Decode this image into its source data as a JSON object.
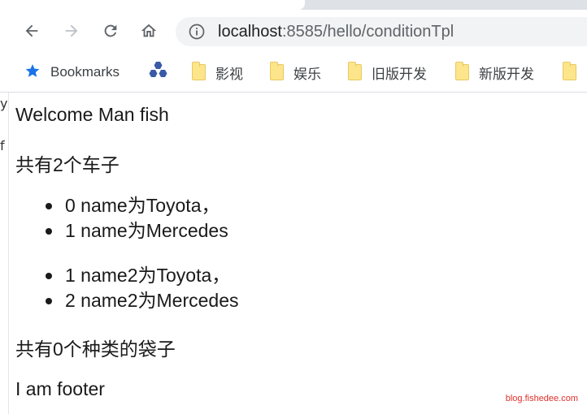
{
  "browser": {
    "url_host": "localhost",
    "url_rest": ":8585/hello/conditionTpl",
    "icons": [
      "back-icon",
      "forward-icon",
      "reload-icon",
      "home-icon",
      "info-icon"
    ]
  },
  "bookmarks": [
    {
      "label": "Bookmarks",
      "icon": "star-icon"
    },
    {
      "label": "",
      "icon": "hexagon-app-icon"
    },
    {
      "label": "影视",
      "icon": "folder-icon"
    },
    {
      "label": "娱乐",
      "icon": "folder-icon"
    },
    {
      "label": "旧版开发",
      "icon": "folder-icon"
    },
    {
      "label": "新版开发",
      "icon": "folder-icon"
    }
  ],
  "left_strip": {
    "chars": [
      "y",
      "f"
    ]
  },
  "page": {
    "welcome": "Welcome Man fish",
    "cars_count": "共有2个车子",
    "list1": [
      "0 name为Toyota，",
      "1 name为Mercedes"
    ],
    "list2": [
      "1 name2为Toyota，",
      "2 name2为Mercedes"
    ],
    "bags_count": "共有0个种类的袋子",
    "footer": "I am footer"
  },
  "watermark": "blog.fishedee.com",
  "colors": {
    "accent": "#1a73e8",
    "folder": "#fde58c",
    "watermark": "#e0302b"
  }
}
